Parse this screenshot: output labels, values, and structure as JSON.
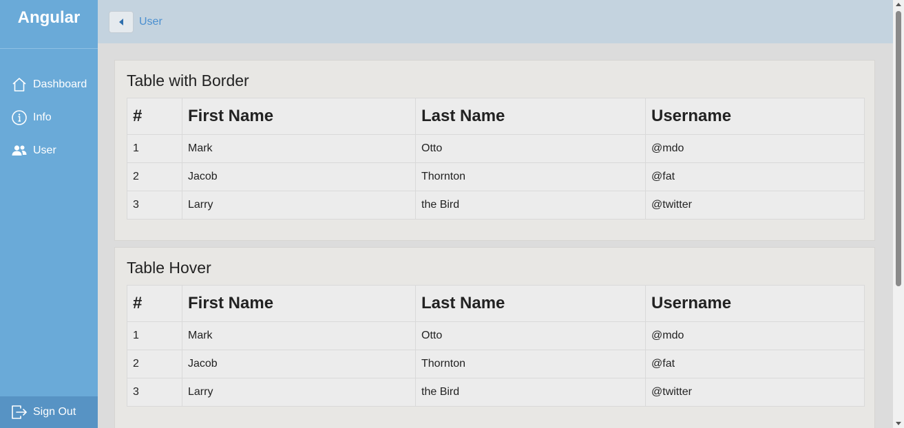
{
  "sidebar": {
    "brand": "Angular",
    "items": [
      {
        "label": "Dashboard",
        "icon": "home-icon"
      },
      {
        "label": "Info",
        "icon": "info-icon"
      },
      {
        "label": "User",
        "icon": "users-icon"
      }
    ],
    "signout": {
      "label": "Sign Out",
      "icon": "sign-out-icon"
    }
  },
  "topbar": {
    "breadcrumb": "User",
    "back_icon": "caret-left-icon"
  },
  "tables": [
    {
      "title": "Table with Border",
      "headers": [
        "#",
        "First Name",
        "Last Name",
        "Username"
      ],
      "rows": [
        [
          "1",
          "Mark",
          "Otto",
          "@mdo"
        ],
        [
          "2",
          "Jacob",
          "Thornton",
          "@fat"
        ],
        [
          "3",
          "Larry",
          "the Bird",
          "@twitter"
        ]
      ]
    },
    {
      "title": "Table Hover",
      "headers": [
        "#",
        "First Name",
        "Last Name",
        "Username"
      ],
      "rows": [
        [
          "1",
          "Mark",
          "Otto",
          "@mdo"
        ],
        [
          "2",
          "Jacob",
          "Thornton",
          "@fat"
        ],
        [
          "3",
          "Larry",
          "the Bird",
          "@twitter"
        ]
      ]
    }
  ],
  "colors": {
    "sidebar": "#6aaad8",
    "signout": "#5793c4",
    "topbar": "#c4d3df",
    "link": "#4a8fd0"
  }
}
